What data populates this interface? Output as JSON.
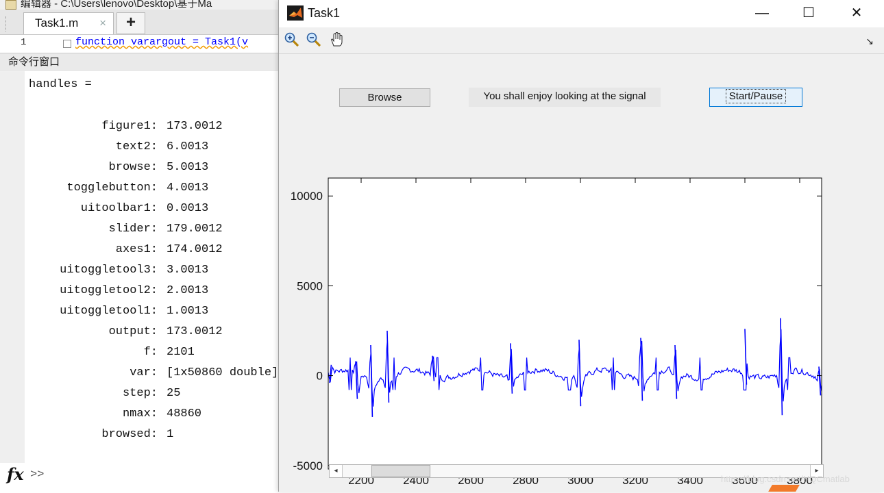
{
  "editor": {
    "title": "编辑器 - C:\\Users\\lenovo\\Desktop\\基于Ma",
    "tab_label": "Task1.m",
    "tab_close": "×",
    "add_tab": "+",
    "line_number": "1",
    "code_preview": "function varargout = Task1(v"
  },
  "command_window": {
    "header": "命令行窗口",
    "handles_label": "handles =",
    "fields": [
      {
        "name": "figure1:",
        "value": "173.0012"
      },
      {
        "name": "text2:",
        "value": "6.0013"
      },
      {
        "name": "browse:",
        "value": "5.0013"
      },
      {
        "name": "togglebutton:",
        "value": "4.0013"
      },
      {
        "name": "uitoolbar1:",
        "value": "0.0013"
      },
      {
        "name": "slider:",
        "value": "179.0012"
      },
      {
        "name": "axes1:",
        "value": "174.0012"
      },
      {
        "name": "uitoggletool3:",
        "value": "3.0013"
      },
      {
        "name": "uitoggletool2:",
        "value": "2.0013"
      },
      {
        "name": "uitoggletool1:",
        "value": "1.0013"
      },
      {
        "name": "output:",
        "value": "173.0012"
      },
      {
        "name": "f:",
        "value": "2101"
      },
      {
        "name": "var:",
        "value": "[1x50860 double]"
      },
      {
        "name": "step:",
        "value": "25"
      },
      {
        "name": "nmax:",
        "value": "48860"
      },
      {
        "name": "browsed:",
        "value": "1"
      }
    ],
    "fx_label": "fx",
    "prompt": ">>"
  },
  "figure": {
    "title": "Task1",
    "minimize": "—",
    "maximize": "☐",
    "close": "✕",
    "tools": {
      "zoom_in": "zoom-in-icon",
      "zoom_out": "zoom-out-icon",
      "pan": "pan-hand-icon"
    },
    "dock": "↘",
    "browse_label": "Browse",
    "status_text": "You shall enjoy looking at the signal",
    "start_pause_label": "Start/Pause",
    "slider_position": 0.06
  },
  "chart_data": {
    "type": "line",
    "xlim": [
      2080,
      3880
    ],
    "ylim": [
      -5200,
      11000
    ],
    "xticks": [
      2200,
      2400,
      2600,
      2800,
      3000,
      3200,
      3400,
      3600,
      3800
    ],
    "yticks": [
      -5000,
      0,
      5000,
      10000
    ],
    "color": "#0000ff",
    "beats": [
      {
        "x": 2085,
        "lo": 600,
        "hi": -400
      },
      {
        "x": 2180,
        "lo": -1300,
        "hi": 800
      },
      {
        "x": 2235,
        "lo": -2300,
        "hi": 1700
      },
      {
        "x": 2295,
        "lo": -1500,
        "hi": 2500
      },
      {
        "x": 2460,
        "lo": -300,
        "hi": 1100
      },
      {
        "x": 2745,
        "lo": -1000,
        "hi": 1800
      },
      {
        "x": 2995,
        "lo": -1700,
        "hi": 2000
      },
      {
        "x": 3220,
        "lo": -1400,
        "hi": 2100
      },
      {
        "x": 3345,
        "lo": -1300,
        "hi": 1700
      },
      {
        "x": 3600,
        "lo": -500,
        "hi": 2600
      },
      {
        "x": 3730,
        "lo": -2200,
        "hi": 3200
      },
      {
        "x": 3870,
        "lo": -1100,
        "hi": 500
      }
    ],
    "baseline": 100
  },
  "watermark": "https://blog.csdn.net/HQCmatlab"
}
